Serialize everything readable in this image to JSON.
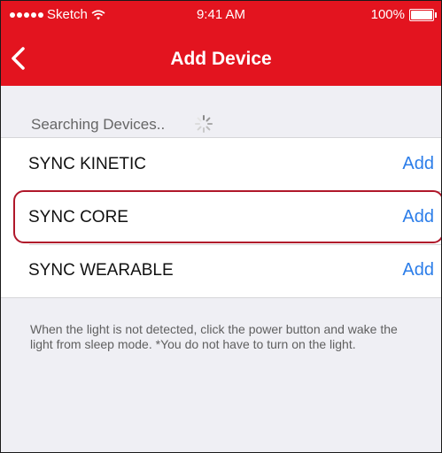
{
  "colors": {
    "brand": "#e3141f",
    "accent": "#2b7de9",
    "highlight": "#b0172a"
  },
  "status_bar": {
    "carrier": "Sketch",
    "time": "9:41 AM",
    "battery": "100%"
  },
  "nav": {
    "back_icon": "chevron-left-icon",
    "title": "Add Device"
  },
  "search": {
    "label": "Searching Devices..",
    "icon": "spinner-icon"
  },
  "devices": [
    {
      "name": "SYNC KINETIC",
      "action": "Add"
    },
    {
      "name": "SYNC CORE",
      "action": "Add"
    },
    {
      "name": "SYNC WEARABLE",
      "action": "Add"
    }
  ],
  "footer": {
    "text": "When the light is not detected, click the power button and wake the light from sleep mode. *You do not have to turn on the light."
  }
}
